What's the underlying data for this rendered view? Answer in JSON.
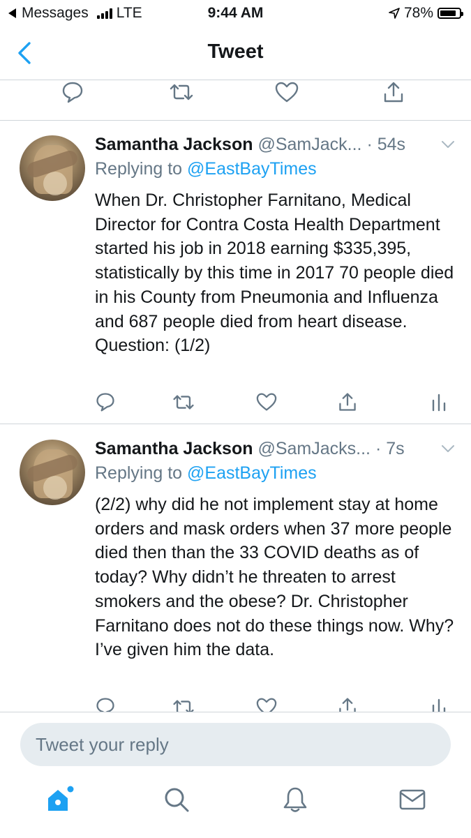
{
  "status_bar": {
    "back_app": "Messages",
    "carrier": "LTE",
    "time": "9:44 AM",
    "battery": "78%"
  },
  "nav": {
    "title": "Tweet"
  },
  "tweets": [
    {
      "name": "Samantha Jackson",
      "handle": "@SamJack...",
      "time": "· 54s",
      "reply_prefix": "Replying to",
      "reply_to": "@EastBayTimes",
      "text": "When Dr. Christopher Farnitano, Medical Director for Contra Costa Health Department started his job in 2018 earning $335,395, statistically by this time in 2017 70 people died in his County from Pneumonia and Influenza and 687 people died from heart disease. Question: (1/2)"
    },
    {
      "name": "Samantha Jackson",
      "handle": "@SamJacks...",
      "time": "· 7s",
      "reply_prefix": "Replying to",
      "reply_to": "@EastBayTimes",
      "text": "(2/2) why did he not implement stay at home orders and mask orders when 37 more people died then than the 33 COVID deaths as of today? Why didn’t he threaten to arrest smokers and the obese? Dr. Christopher Farnitano does not do these things now. Why? I’ve given him the data."
    }
  ],
  "reply_box": {
    "placeholder": "Tweet your reply"
  },
  "icons": {
    "reply": "reply-icon",
    "retweet": "retweet-icon",
    "like": "heart-icon",
    "share": "share-icon",
    "analytics": "analytics-icon",
    "home": "home-icon",
    "search": "search-icon",
    "notifications": "bell-icon",
    "messages": "mail-icon"
  },
  "colors": {
    "accent": "#1da1f2",
    "secondary_text": "#657786",
    "icon": "#657786",
    "divider": "#cfd5da",
    "reply_box_bg": "#e6ecf0"
  }
}
